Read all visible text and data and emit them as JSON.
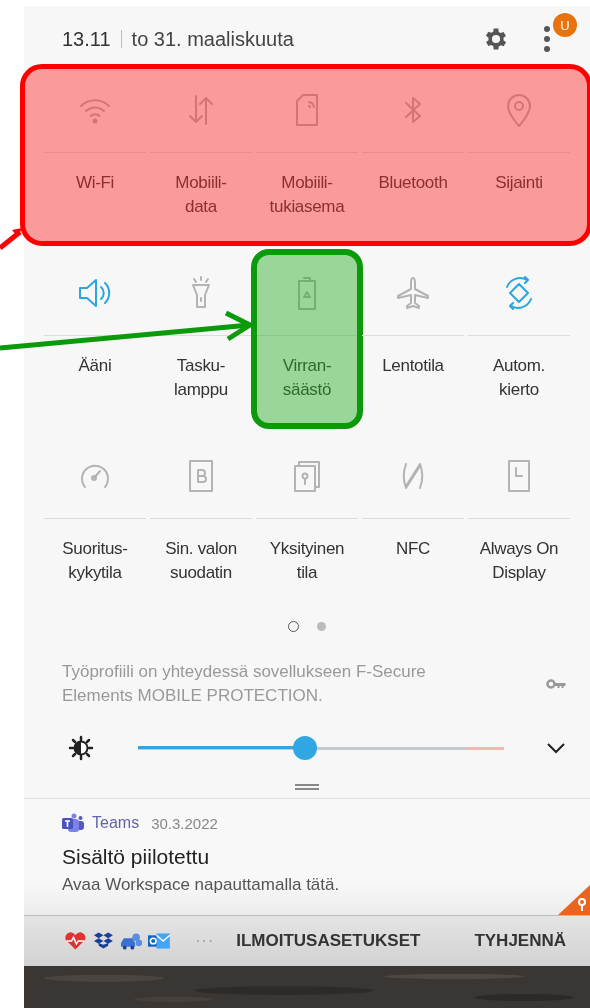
{
  "status": {
    "time": "13.11",
    "date": "to 31. maaliskuuta",
    "badge": "U"
  },
  "tile_rows": [
    {
      "highlighted": true,
      "tiles": [
        {
          "kind": "wifi",
          "label": "Wi-Fi",
          "on": false,
          "highlighted": false
        },
        {
          "kind": "data",
          "label": "Mobiili-\ndata",
          "on": false,
          "highlighted": false
        },
        {
          "kind": "hotspot",
          "label": "Mobiili-\ntukiasema",
          "on": false,
          "highlighted": false
        },
        {
          "kind": "bluetooth",
          "label": "Bluetooth",
          "on": false,
          "highlighted": false
        },
        {
          "kind": "location",
          "label": "Sijainti",
          "on": false,
          "highlighted": false
        }
      ]
    },
    {
      "highlighted": false,
      "tiles": [
        {
          "kind": "sound",
          "label": "Ääni",
          "on": true,
          "highlighted": false
        },
        {
          "kind": "flashlight",
          "label": "Tasku-\nlamppu",
          "on": false,
          "highlighted": false
        },
        {
          "kind": "battery",
          "label": "Virran-\nsäästö",
          "on": false,
          "highlighted": true
        },
        {
          "kind": "airplane",
          "label": "Lentotila",
          "on": false,
          "highlighted": false
        },
        {
          "kind": "rotate",
          "label": "Autom.\nkierto",
          "on": true,
          "highlighted": false
        }
      ]
    },
    {
      "highlighted": false,
      "tiles": [
        {
          "kind": "gauge",
          "label": "Suoritus-\nkykytila",
          "on": false,
          "highlighted": false
        },
        {
          "kind": "filter",
          "label": "Sin. valon\nsuodatin",
          "on": false,
          "highlighted": false
        },
        {
          "kind": "secure",
          "label": "Yksityinen\ntila",
          "on": false,
          "highlighted": false
        },
        {
          "kind": "nfc",
          "label": "NFC",
          "on": false,
          "highlighted": false
        },
        {
          "kind": "aod",
          "label": "Always On\nDisplay",
          "on": false,
          "highlighted": false
        }
      ]
    }
  ],
  "pages": [
    {
      "selected": true
    },
    {
      "selected": false
    }
  ],
  "work_profile": {
    "text": "Työprofiili on yhteydessä sovellukseen F-Secure Elements MOBILE PROTECTION."
  },
  "brightness": {
    "level": 0.457
  },
  "notification": {
    "app": "Teams",
    "date": "30.3.2022",
    "title": "Sisältö piilotettu",
    "body": "Avaa Workspace napauttamalla tätä."
  },
  "bottom_bar": {
    "more": "···",
    "buttons": [
      "ILMOITUSASETUKSET",
      "TYHJENNÄ"
    ]
  }
}
